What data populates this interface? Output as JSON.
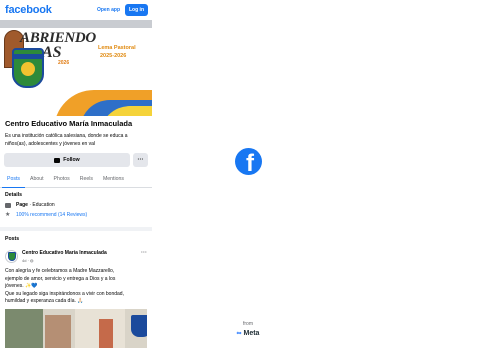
{
  "topbar": {
    "logo": "facebook",
    "open_app": "Open app",
    "login": "Log in"
  },
  "cover": {
    "title_line1": "ABRIENDO",
    "title_line2": "AS",
    "year": "2026",
    "lemo": "Lema Pastoral",
    "lemo_years": "2025-2026"
  },
  "page": {
    "name": "Centro Educativo María Inmaculada",
    "description": "Es una institución católica salesiana, donde se educa a niños(as), adolescentes y jóvenes en val"
  },
  "actions": {
    "follow": "Follow",
    "more": "···"
  },
  "tabs": [
    "Posts",
    "About",
    "Photos",
    "Reels",
    "Mentions"
  ],
  "details": {
    "title": "Details",
    "page_label": "Page",
    "category": "Education",
    "recommend": "100% recommend (14 Reviews)"
  },
  "posts": {
    "title": "Posts",
    "items": [
      {
        "author": "Centro Educativo María Inmaculada",
        "meta": "4d · ",
        "more": "···",
        "text_lines": [
          "Con alegría y fe celebramos a Madre Mazzarello,",
          "ejemplo de amor, servicio y entrega a Dios y a los",
          "jóvenes. ✨💙",
          "Que su legado siga inspirándonos a vivir con bondad,",
          "humildad y esperanza cada día. 🙏🏻"
        ]
      }
    ]
  },
  "footer": {
    "from": "from",
    "meta": "Meta"
  },
  "colors": {
    "brand": "#1877f2",
    "button_bg": "#e4e6eb",
    "muted": "#65676b"
  }
}
